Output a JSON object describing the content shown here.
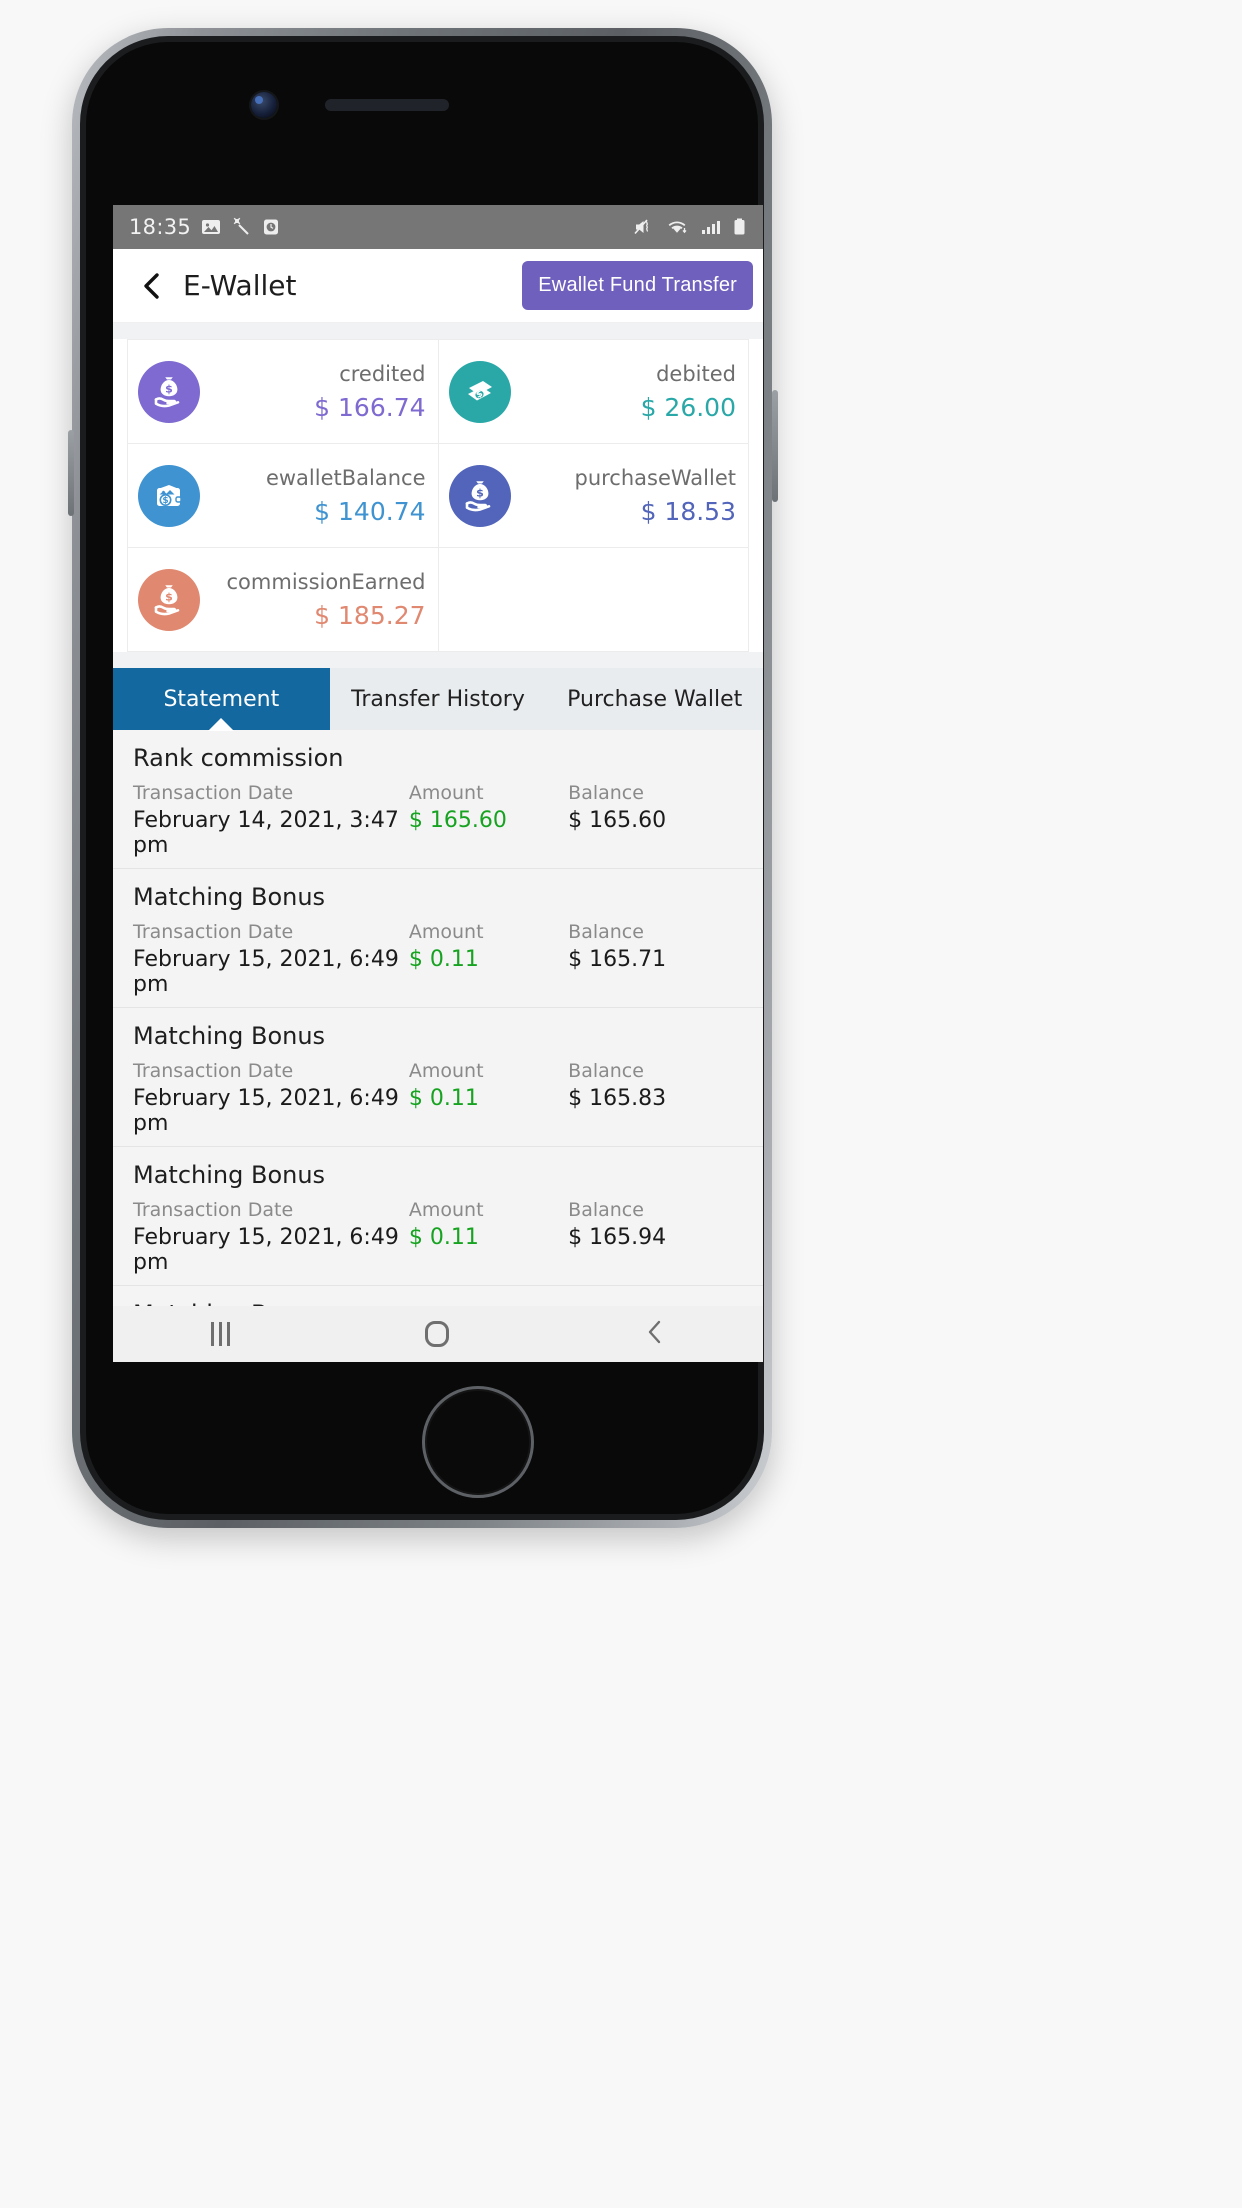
{
  "statusbar": {
    "time": "18:35",
    "left_icons": [
      "image-icon",
      "magic-wand-icon",
      "clock-icon"
    ],
    "right_icons": [
      "mute-vibrate-icon",
      "wifi-icon",
      "signal-icon",
      "battery-icon"
    ]
  },
  "header": {
    "back_icon": "back-chevron-icon",
    "title": "E-Wallet",
    "action_button": "Ewallet Fund Transfer",
    "action_color": "#6f60bd"
  },
  "stats": [
    {
      "label": "credited",
      "value": "$ 166.74",
      "color": "#7e6ad0",
      "icon": "money-bag-hand-icon"
    },
    {
      "label": "debited",
      "value": "$ 26.00",
      "color": "#2aa8a8",
      "icon": "cash-notes-icon"
    },
    {
      "label": "ewalletBalance",
      "value": "$ 140.74",
      "color": "#3f93d1",
      "icon": "wallet-icon"
    },
    {
      "label": "purchaseWallet",
      "value": "$ 18.53",
      "color": "#5265ba",
      "icon": "money-bag-hand-icon"
    },
    {
      "label": "commissionEarned",
      "value": "$ 185.27",
      "color": "#e08870",
      "icon": "money-bag-hand-icon"
    }
  ],
  "tabs": [
    {
      "label": "Statement",
      "active": true
    },
    {
      "label": "Transfer History",
      "active": false
    },
    {
      "label": "Purchase Wallet",
      "active": false
    }
  ],
  "columns": {
    "date": "Transaction Date",
    "amount": "Amount",
    "balance": "Balance"
  },
  "transactions": [
    {
      "title": "Rank commission",
      "date": "February 14, 2021, 3:47 pm",
      "amount": "$ 165.60",
      "balance": "$ 165.60"
    },
    {
      "title": "Matching Bonus",
      "date": "February 15, 2021, 6:49 pm",
      "amount": "$ 0.11",
      "balance": "$ 165.71"
    },
    {
      "title": "Matching Bonus",
      "date": "February 15, 2021, 6:49 pm",
      "amount": "$ 0.11",
      "balance": "$ 165.83"
    },
    {
      "title": "Matching Bonus",
      "date": "February 15, 2021, 6:49 pm",
      "amount": "$ 0.11",
      "balance": "$ 165.94"
    },
    {
      "title": "Matching Bonus",
      "date": "",
      "amount": "",
      "balance": ""
    }
  ],
  "navbar": {
    "recents": "recents-icon",
    "home": "home-icon",
    "back": "back-icon"
  }
}
